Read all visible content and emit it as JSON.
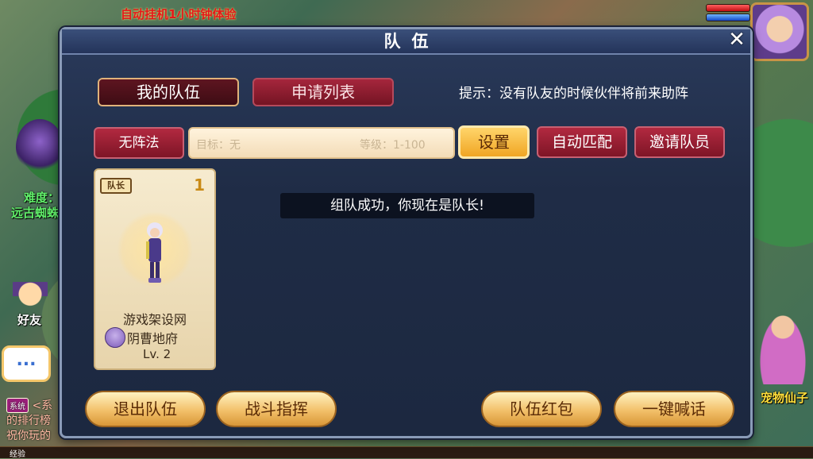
{
  "background": {
    "top_notice": "自动挂机1小时钟体验",
    "difficulty_label": "难度：",
    "monster_label": "远古蜘蛛",
    "friend_label": "好友",
    "chat_icon": "...",
    "system_badge": "系统",
    "system_lines": [
      "<系",
      "的排行榜",
      "祝你玩的"
    ],
    "pet_label": "宠物仙子",
    "exp_label": "经验"
  },
  "dialog": {
    "title": "队伍",
    "close_icon": "✕"
  },
  "tabs": {
    "my_team": "我的队伍",
    "apply_list": "申请列表"
  },
  "hint": "提示：没有队友的时候伙伴将前来助阵",
  "toolbar": {
    "formation": "无阵法",
    "target_placeholder": "目标：无",
    "level_placeholder": "等级：1-100",
    "setup": "设置",
    "auto_match": "自动匹配",
    "invite": "邀请队员"
  },
  "members": [
    {
      "badge": "队长",
      "slot": "1",
      "name": "游戏架设网",
      "sect": "阴曹地府",
      "level": "Lv. 2"
    }
  ],
  "toast": "组队成功，你现在是队长!",
  "actions": {
    "leave": "退出队伍",
    "command": "战斗指挥",
    "red_packet": "队伍红包",
    "shout": "一键喊话"
  },
  "colors": {
    "panel_bg": "#1f2c46",
    "tab_active": "#5e1520",
    "button_red": "#b22940",
    "button_gold": "#f2c06a",
    "card_bg": "#f6ebcf"
  }
}
